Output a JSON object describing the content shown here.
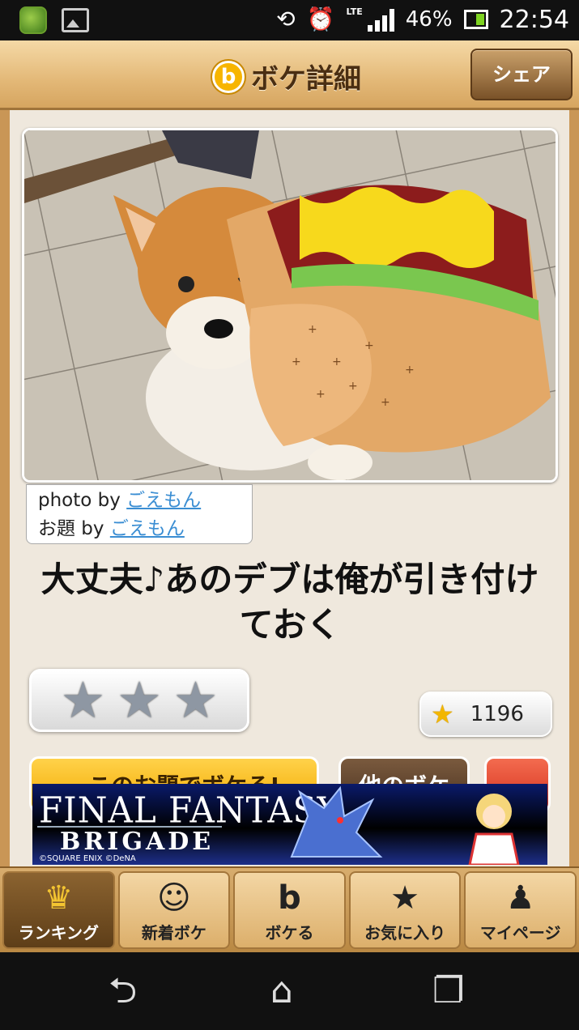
{
  "status_bar": {
    "battery": "46%",
    "time": "22:54",
    "network": "LTE",
    "icons": [
      "app-icon",
      "gallery-icon",
      "rotate-icon",
      "alarm-icon",
      "signal-icon",
      "battery-icon"
    ]
  },
  "header": {
    "title": "ボケ詳細",
    "logo_letter": "b",
    "share_label": "シェア"
  },
  "post": {
    "credit_photo_prefix": "photo by ",
    "credit_photo_user": "ごえもん",
    "credit_theme_prefix": "お題 by ",
    "credit_theme_user": "ごえもん",
    "caption": "大丈夫♪あのデブは俺が引き付けておく",
    "rating_stars": [
      "★",
      "★",
      "★"
    ],
    "star_count": "1196"
  },
  "buttons": {
    "boke_this_theme": "このお題でボケる!",
    "other_boke": "他のボケ"
  },
  "ad": {
    "title": "FINAL FANTASY",
    "subtitle": "BRIGADE",
    "copyright": "©SQUARE ENIX ©DeNA"
  },
  "tabs": [
    {
      "label": "ランキング",
      "icon": "crown-icon",
      "glyph": "♛",
      "active": true
    },
    {
      "label": "新着ボケ",
      "icon": "face-icon",
      "glyph": "☺",
      "active": false
    },
    {
      "label": "ボケる",
      "icon": "boke-icon",
      "glyph": "b",
      "active": false
    },
    {
      "label": "お気に入り",
      "icon": "star-icon",
      "glyph": "★",
      "active": false
    },
    {
      "label": "マイページ",
      "icon": "bell-icon",
      "glyph": "♟",
      "active": false
    }
  ],
  "colors": {
    "header_wood": "#e3b877",
    "accent_yellow": "#f3a900",
    "link_blue": "#3b8ed3",
    "active_tab": "#5e3e18"
  }
}
